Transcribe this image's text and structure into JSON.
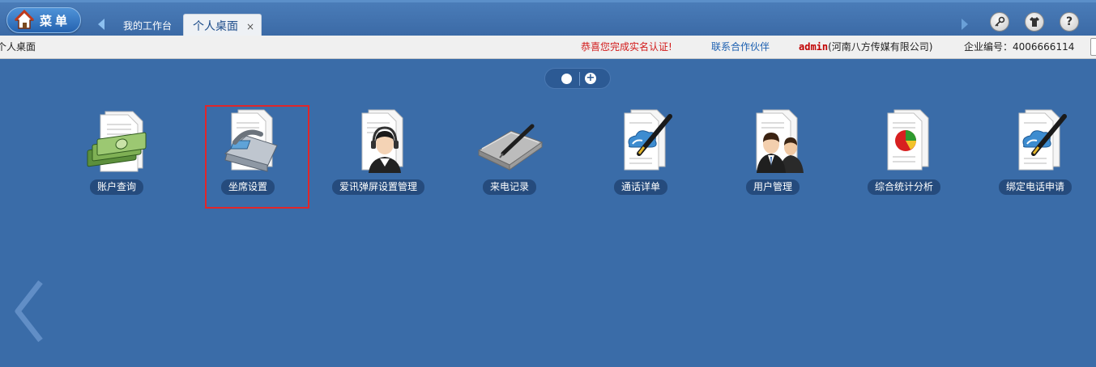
{
  "header": {
    "menu_label": "菜单",
    "tabs": [
      {
        "label": "我的工作台"
      },
      {
        "label": "个人桌面",
        "close": "×"
      }
    ],
    "tools": {
      "help": "?"
    }
  },
  "statusbar": {
    "location": "个人桌面",
    "congrats": "恭喜您完成实名认证!",
    "contact": "联系合作伙伴",
    "user_name": "admin",
    "company": "(河南八方传媒有限公司)",
    "code": "企业编号：4006666114"
  },
  "pager": {
    "plus": "+"
  },
  "apps": [
    {
      "label": "账户查询",
      "icon": "money-document-icon"
    },
    {
      "label": "坐席设置",
      "icon": "phone-document-icon"
    },
    {
      "label": "爱讯弹屏设置管理",
      "icon": "headset-agent-icon"
    },
    {
      "label": "来电记录",
      "icon": "folder-pen-icon"
    },
    {
      "label": "通话详单",
      "icon": "cloud-pen-document-icon"
    },
    {
      "label": "用户管理",
      "icon": "users-document-icon"
    },
    {
      "label": "综合统计分析",
      "icon": "pie-chart-document-icon"
    },
    {
      "label": "绑定电话申请",
      "icon": "cloud-pen-document-icon"
    }
  ],
  "colors": {
    "desktop_bg": "#3a6ca8",
    "highlight": "#e0262a",
    "congrats": "#d21a1a",
    "contact": "#1b5fb0"
  }
}
